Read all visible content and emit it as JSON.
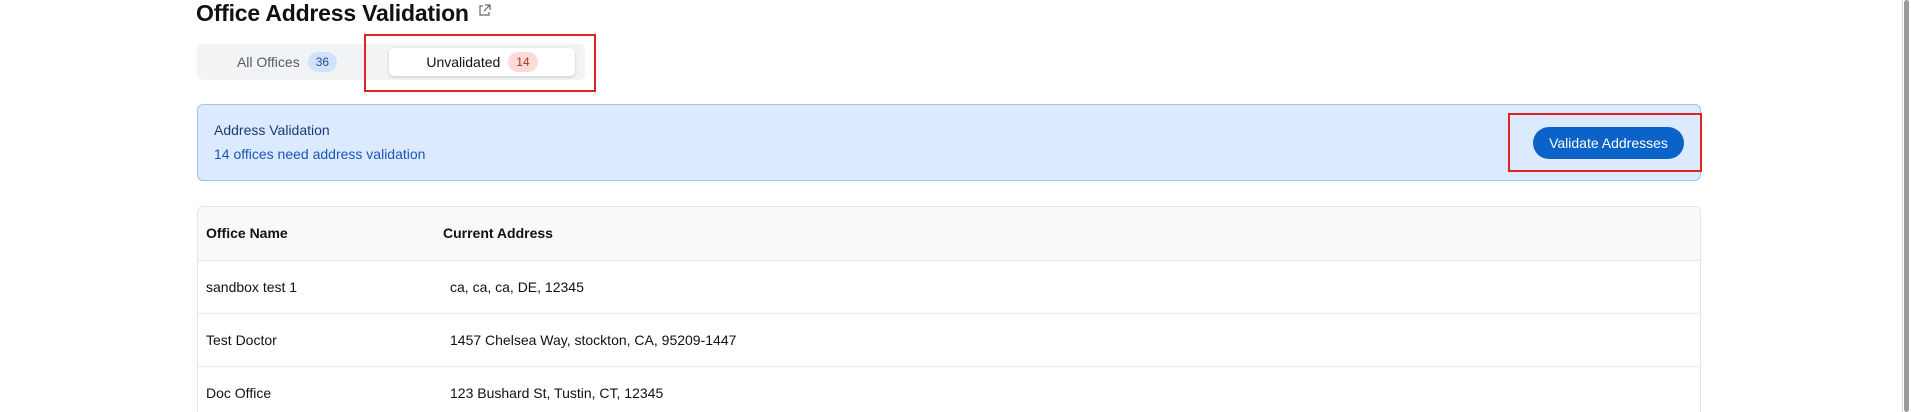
{
  "page": {
    "title": "Office Address Validation",
    "title_icon": "external-link-icon"
  },
  "tabs": [
    {
      "label": "All Offices",
      "count": "36",
      "selected": false
    },
    {
      "label": "Unvalidated",
      "count": "14",
      "selected": true
    }
  ],
  "alert": {
    "title": "Address Validation",
    "description": "14 offices need address validation",
    "button_label": "Validate Addresses"
  },
  "table": {
    "headers": [
      "Office Name",
      "Current Address"
    ],
    "rows": [
      {
        "name": "sandbox test 1",
        "address": "ca, ca, ca, DE, 12345"
      },
      {
        "name": "Test Doctor",
        "address": "1457 Chelsea Way, stockton, CA, 95209-1447"
      },
      {
        "name": "Doc Office",
        "address": "123 Bushard St, Tustin, CT, 12345"
      }
    ]
  },
  "colors": {
    "accent": "#0b63c9",
    "alert_bg": "#dbeafe",
    "highlight": "#e02424"
  }
}
